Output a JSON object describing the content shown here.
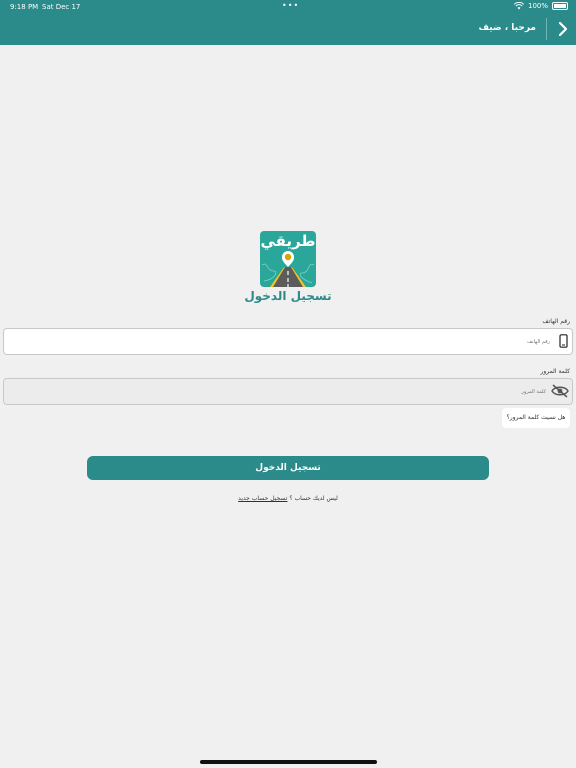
{
  "status_bar": {
    "time": "9:18 PM",
    "date": "Sat Dec 17",
    "dots": "•••",
    "battery": "100%"
  },
  "nav": {
    "title": "مرحبا ، ضيف",
    "back_icon": "chevron-right-icon"
  },
  "logo": {
    "word": "طريقي",
    "caption": "تسجيل الدخول"
  },
  "phone": {
    "label": "رقم الهاتف",
    "placeholder": "رقم الهاتف",
    "icon": "phone-icon"
  },
  "password": {
    "label": "كلمة المرور",
    "placeholder": "كلمة المرور",
    "icon": "eye-off-icon"
  },
  "forgot_password": "هل نسيت كلمة المرور؟",
  "login_button": "تسجيل الدخول",
  "register": {
    "prompt": "ليس لديك حساب ؟",
    "link": "تسجيل حساب جديد"
  },
  "colors": {
    "primary": "#2b8a8a",
    "logo_bg": "#2aa79a",
    "background": "#f0f0f0"
  }
}
